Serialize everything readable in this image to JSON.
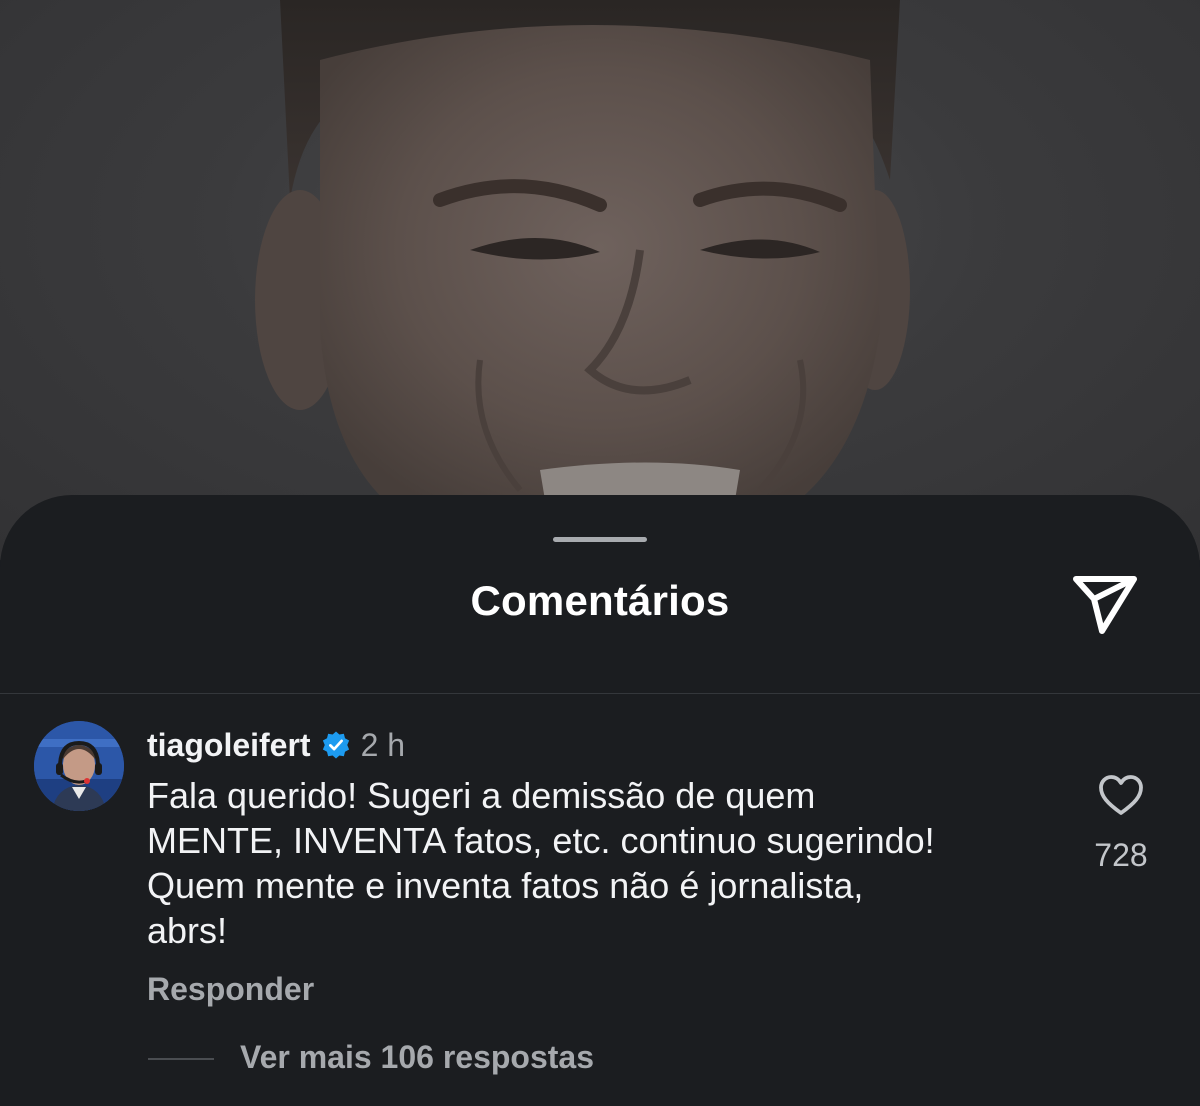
{
  "background": {
    "image": "man-smiling-photo",
    "dimmed": true
  },
  "sheet": {
    "title": "Comentários",
    "share_icon": "paper-plane-icon"
  },
  "comment": {
    "username": "tiagoleifert",
    "verified": true,
    "time": "2 h",
    "text_lines": [
      "Fala querido! Sugeri a demissão de quem",
      "MENTE, INVENTA fatos, etc. continuo sugerindo!",
      "Quem mente e inventa fatos não é jornalista,",
      "abrs!"
    ],
    "likes": "728",
    "reply_label": "Responder",
    "more_replies_label": "Ver mais 106 respostas"
  },
  "colors": {
    "sheet_bg": "#1b1d20",
    "verified_blue": "#1d9bf0",
    "text_primary": "#f2f3f5",
    "text_secondary": "#a6a9ad"
  }
}
